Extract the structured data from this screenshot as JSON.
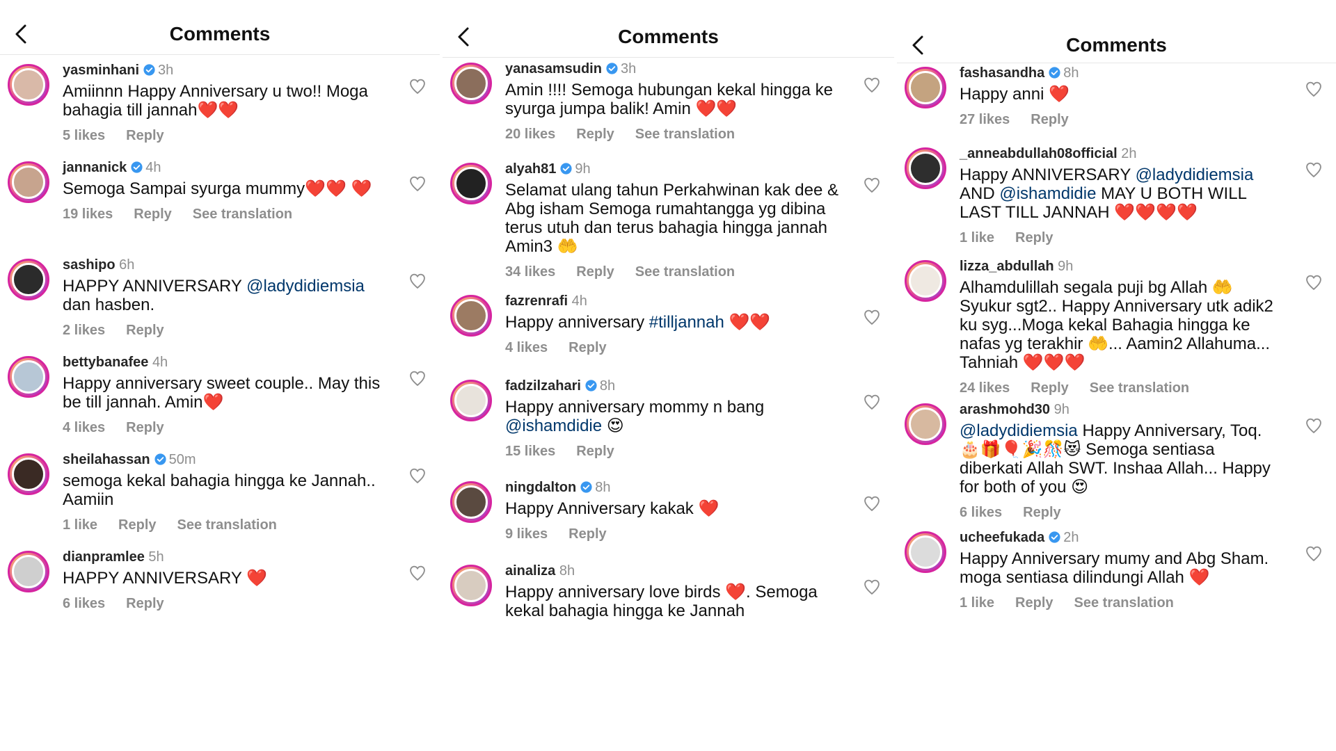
{
  "colors": {
    "verified": "#3897f0",
    "heart_red": "#e0245e",
    "mention": "#00376b",
    "gray": "#8e8e8e"
  },
  "icons": {
    "back": "chevron-left-icon",
    "like": "heart-outline-icon",
    "verified": "verified-badge-icon"
  },
  "panels": [
    {
      "title": "Comments",
      "comments": [
        {
          "username": "yasminhani",
          "verified": true,
          "time": "3h",
          "text_parts": [
            {
              "t": "Amiinnn Happy Anniversary u two!! Moga bahagia till jannah❤️❤️"
            }
          ],
          "likes": "5 likes",
          "reply": "Reply",
          "translation": ""
        },
        {
          "username": "jannanick",
          "verified": true,
          "time": "4h",
          "text_parts": [
            {
              "t": "Semoga Sampai syurga mummy❤️❤️ ❤️"
            }
          ],
          "likes": "19 likes",
          "reply": "Reply",
          "translation": "See translation"
        },
        {
          "username": "sashipo",
          "verified": false,
          "time": "6h",
          "text_parts": [
            {
              "t": "HAPPY ANNIVERSARY "
            },
            {
              "t": "@ladydidiemsia",
              "m": true
            },
            {
              "t": " dan hasben."
            }
          ],
          "likes": "2 likes",
          "reply": "Reply",
          "translation": ""
        },
        {
          "username": "bettybanafee",
          "verified": false,
          "time": "4h",
          "text_parts": [
            {
              "t": "Happy anniversary sweet couple.. May this be till jannah. Amin❤️"
            }
          ],
          "likes": "4 likes",
          "reply": "Reply",
          "translation": ""
        },
        {
          "username": "sheilahassan",
          "verified": true,
          "time": "50m",
          "text_parts": [
            {
              "t": "semoga kekal bahagia hingga ke Jannah.. Aamiin"
            }
          ],
          "likes": "1 like",
          "reply": "Reply",
          "translation": "See translation"
        },
        {
          "username": "dianpramlee",
          "verified": false,
          "time": "5h",
          "text_parts": [
            {
              "t": "HAPPY ANNIVERSARY ❤️"
            }
          ],
          "likes": "6 likes",
          "reply": "Reply",
          "translation": ""
        }
      ]
    },
    {
      "title": "Comments",
      "comments": [
        {
          "username": "yanasamsudin",
          "verified": true,
          "time": "3h",
          "text_parts": [
            {
              "t": "Amin !!!! Semoga hubungan kekal hingga ke syurga jumpa balik! Amin ❤️❤️"
            }
          ],
          "likes": "20 likes",
          "reply": "Reply",
          "translation": "See translation"
        },
        {
          "username": "alyah81",
          "verified": true,
          "time": "9h",
          "text_parts": [
            {
              "t": "Selamat ulang tahun Perkahwinan kak dee & Abg isham Semoga rumahtangga yg dibina terus utuh dan terus bahagia hingga jannah Amin3 🤲"
            }
          ],
          "likes": "34 likes",
          "reply": "Reply",
          "translation": "See translation"
        },
        {
          "username": "fazrenrafi",
          "verified": false,
          "time": "4h",
          "text_parts": [
            {
              "t": "Happy anniversary "
            },
            {
              "t": "#tilljannah",
              "m": true
            },
            {
              "t": " ❤️❤️"
            }
          ],
          "likes": "4 likes",
          "reply": "Reply",
          "translation": ""
        },
        {
          "username": "fadzilzahari",
          "verified": true,
          "time": "8h",
          "text_parts": [
            {
              "t": "Happy anniversary mommy n bang "
            },
            {
              "t": "@ishamdidie",
              "m": true
            },
            {
              "t": " 😍"
            }
          ],
          "likes": "15 likes",
          "reply": "Reply",
          "translation": ""
        },
        {
          "username": "ningdalton",
          "verified": true,
          "time": "8h",
          "text_parts": [
            {
              "t": "Happy Anniversary kakak ❤️"
            }
          ],
          "likes": "9 likes",
          "reply": "Reply",
          "translation": ""
        },
        {
          "username": "ainaliza",
          "verified": false,
          "time": "8h",
          "text_parts": [
            {
              "t": "Happy anniversary love birds ❤️. Semoga kekal bahagia hingga ke Jannah"
            }
          ],
          "likes": "",
          "reply": "",
          "translation": ""
        }
      ]
    },
    {
      "title": "Comments",
      "comments": [
        {
          "username": "fashasandha",
          "verified": true,
          "time": "8h",
          "text_parts": [
            {
              "t": "Happy anni ❤️"
            }
          ],
          "likes": "27 likes",
          "reply": "Reply",
          "translation": ""
        },
        {
          "username": "_anneabdullah08official",
          "verified": false,
          "time": "2h",
          "text_parts": [
            {
              "t": "Happy ANNIVERSARY "
            },
            {
              "t": "@ladydidiemsia",
              "m": true
            },
            {
              "t": " AND "
            },
            {
              "t": "@ishamdidie",
              "m": true
            },
            {
              "t": "  MAY U BOTH WILL LAST TILL JANNAH ❤️❤️❤️❤️"
            }
          ],
          "likes": "1 like",
          "reply": "Reply",
          "translation": ""
        },
        {
          "username": "lizza_abdullah",
          "verified": false,
          "time": "9h",
          "text_parts": [
            {
              "t": "Alhamdulillah segala puji bg Allah 🤲 Syukur sgt2.. Happy Anniversary utk adik2 ku syg...Moga kekal Bahagia hingga ke nafas yg terakhir 🤲... Aamin2 Allahuma... Tahniah ❤️❤️❤️"
            }
          ],
          "likes": "24 likes",
          "reply": "Reply",
          "translation": "See translation"
        },
        {
          "username": "arashmohd30",
          "verified": false,
          "time": "9h",
          "text_parts": [
            {
              "t": "@ladydidiemsia",
              "m": true
            },
            {
              "t": " Happy Anniversary, Toq. 🎂🎁🎈🎉🎊😻 Semoga sentiasa diberkati Allah SWT. Inshaa Allah... Happy for both of you 😍"
            }
          ],
          "likes": "6 likes",
          "reply": "Reply",
          "translation": ""
        },
        {
          "username": "ucheefukada",
          "verified": true,
          "time": "2h",
          "text_parts": [
            {
              "t": "Happy Anniversary mumy and Abg Sham. moga sentiasa dilindungi Allah ❤️"
            }
          ],
          "likes": "1 like",
          "reply": "Reply",
          "translation": "See translation"
        }
      ]
    }
  ]
}
